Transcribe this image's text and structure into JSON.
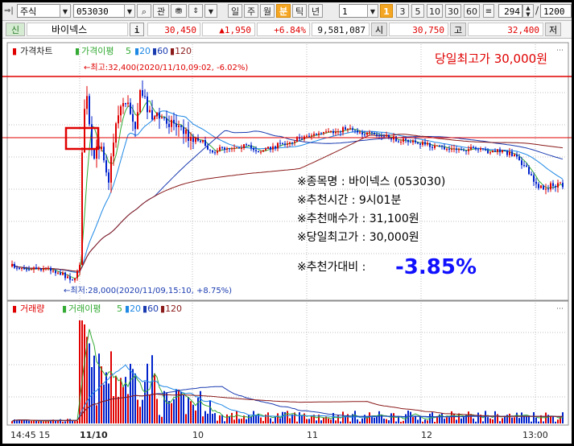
{
  "toolbar": {
    "market": "주식",
    "code": "053030",
    "btn_gwan": "관",
    "periods": [
      "일",
      "주",
      "월",
      "분",
      "틱",
      "년"
    ],
    "active_period": "분",
    "interval_value": "1",
    "badge_num": "1",
    "quick_intervals": [
      "3",
      "5",
      "10",
      "30",
      "60"
    ],
    "count_value": "294",
    "max_value": "1200"
  },
  "quote": {
    "tag": "신",
    "name": "바이넥스",
    "info_icon_label": "i",
    "price": "30,450",
    "change": "▲1,950",
    "change_pct": "+6.84%",
    "volume": "9,581,087",
    "open_label": "시",
    "open": "30,750",
    "high_label": "고",
    "high": "32,400",
    "low_label": "저"
  },
  "price_panel": {
    "legend_main": "가격차트",
    "legend_ma": "가격이평",
    "ma_periods": [
      "5",
      "20",
      "60",
      "120"
    ],
    "max_note": "←최고:32,400(2020/11/10,09:02, -6.02%)",
    "min_note": "←최저:28,000(2020/11/09,15:10, +8.75%)",
    "y_axis_label": ""
  },
  "volume_panel": {
    "legend_main": "거래량",
    "legend_ma": "거래이평",
    "ma_periods": [
      "5",
      "20",
      "60",
      "120"
    ]
  },
  "time_axis": [
    "14:45 15",
    "11/10",
    "10",
    "11",
    "12",
    "13:00"
  ],
  "overlay": {
    "headline": "당일최고가 30,000원",
    "lines": [
      "※종목명 : 바이넥스 (053030)",
      "※추천시간 : 9시01분",
      "※추천매수가 : 31,100원",
      "※당일최고가 : 30,000원"
    ],
    "change_label": "※추천가대비 :",
    "change_value": "-3.85%"
  },
  "colors": {
    "up": "#e00000",
    "down": "#0022cc",
    "ma5": "#33aa33",
    "ma20": "#1e88e5",
    "ma60": "#1a3bb0",
    "ma120": "#8b1a1a",
    "accent_orange": "#f5a623",
    "change_blue": "#1010ff"
  }
}
